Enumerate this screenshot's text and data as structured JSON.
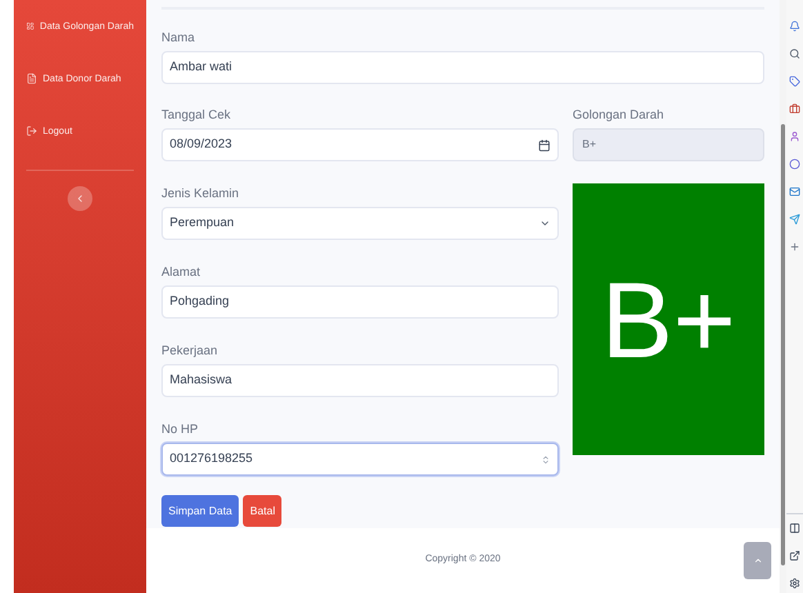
{
  "sidebar": {
    "items": [
      {
        "label": "Data Golongan Darah"
      },
      {
        "label": "Data Donor Darah"
      },
      {
        "label": "Logout"
      }
    ]
  },
  "form": {
    "name_field": {
      "label": "Nama",
      "value": "Ambar wati"
    },
    "fields": [
      {
        "label": "Tanggal Cek",
        "value": "08/09/2023",
        "kind": "date",
        "focused": false
      },
      {
        "label": "Jenis Kelamin",
        "value": "Perempuan",
        "kind": "select",
        "focused": false
      },
      {
        "label": "Alamat",
        "value": "Pohgading",
        "kind": "text",
        "focused": false
      },
      {
        "label": "Pekerjaan",
        "value": "Mahasiswa",
        "kind": "text",
        "focused": false
      },
      {
        "label": "No HP",
        "value": "001276198255",
        "kind": "number",
        "focused": true
      }
    ],
    "blood_field": {
      "label": "Golongan Darah",
      "value": "B+",
      "disabled": true
    },
    "blood_card": {
      "text": "B+"
    },
    "buttons": [
      {
        "label": "Simpan Data",
        "kind": "primary"
      },
      {
        "label": "Batal",
        "kind": "danger"
      }
    ]
  },
  "footer": {
    "text": "Copyright © 2020"
  }
}
